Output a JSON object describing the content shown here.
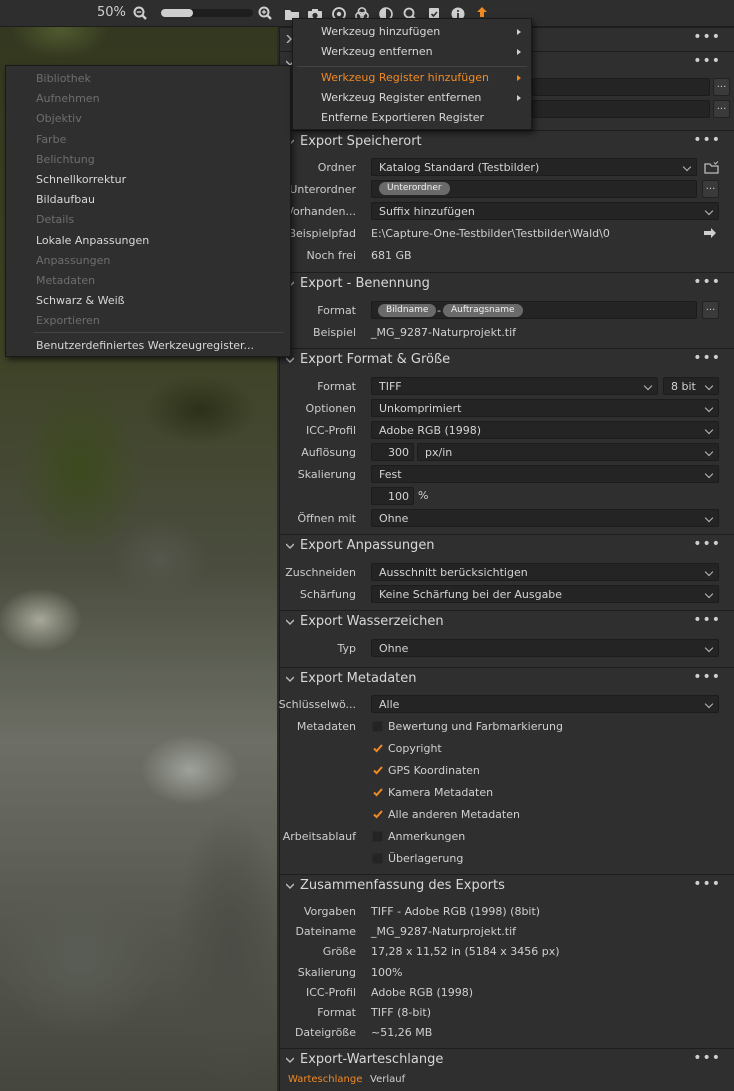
{
  "toolbar": {
    "zoom_percent": "50%",
    "zoom_level": 0.35
  },
  "menu_left": {
    "items": [
      {
        "label": "Bibliothek",
        "enabled": false
      },
      {
        "label": "Aufnehmen",
        "enabled": false
      },
      {
        "label": "Objektiv",
        "enabled": false
      },
      {
        "label": "Farbe",
        "enabled": false
      },
      {
        "label": "Belichtung",
        "enabled": false
      },
      {
        "label": "Schnellkorrektur",
        "enabled": true
      },
      {
        "label": "Bildaufbau",
        "enabled": true
      },
      {
        "label": "Details",
        "enabled": false
      },
      {
        "label": "Lokale Anpassungen",
        "enabled": true
      },
      {
        "label": "Anpassungen",
        "enabled": false
      },
      {
        "label": "Metadaten",
        "enabled": false
      },
      {
        "label": "Schwarz & Weiß",
        "enabled": true
      },
      {
        "label": "Exportieren",
        "enabled": false
      }
    ],
    "custom": "Benutzerdefiniertes Werkzeugregister..."
  },
  "menu_right": {
    "items": [
      {
        "label": "Werkzeug hinzufügen",
        "submenu": true
      },
      {
        "label": "Werkzeug entfernen",
        "submenu": true
      },
      {
        "label": "Werkzeug Register hinzufügen",
        "submenu": true,
        "highlighted": true
      },
      {
        "label": "Werkzeug Register entfernen",
        "submenu": true
      },
      {
        "label": "Entferne Exportieren Register",
        "submenu": false
      }
    ]
  },
  "speicherort": {
    "title": "Export Speicherort",
    "ordner_label": "Ordner",
    "ordner_value": "Katalog Standard (Testbilder)",
    "unterordner_label": "Unterordner",
    "unterordner_pill": "Unterordner",
    "vorhanden_label": "Vorhanden...",
    "vorhanden_value": "Suffix hinzufügen",
    "beispielpfad_label": "Beispielpfad",
    "beispielpfad_value": "E:\\Capture-One-Testbilder\\Testbilder\\Wald\\0",
    "nochfrei_label": "Noch frei",
    "nochfrei_value": "681 GB"
  },
  "benennung": {
    "title": "Export - Benennung",
    "format_label": "Format",
    "pill1": "Bildname",
    "dash": "-",
    "pill2": "Auftragsname",
    "beispiel_label": "Beispiel",
    "beispiel_value": "_MG_9287-Naturprojekt.tif"
  },
  "format": {
    "title": "Export Format & Größe",
    "format_label": "Format",
    "format_value": "TIFF",
    "bit_value": "8 bit",
    "optionen_label": "Optionen",
    "optionen_value": "Unkomprimiert",
    "icc_label": "ICC-Profil",
    "icc_value": "Adobe RGB (1998)",
    "aufl_label": "Auflösung",
    "aufl_value": "300",
    "aufl_unit": "px/in",
    "skal_label": "Skalierung",
    "skal_value": "Fest",
    "percent_value": "100",
    "percent_sign": "%",
    "oeffnen_label": "Öffnen mit",
    "oeffnen_value": "Ohne"
  },
  "anpassungen": {
    "title": "Export Anpassungen",
    "zuschneiden_label": "Zuschneiden",
    "zuschneiden_value": "Ausschnitt berücksichtigen",
    "schaerfung_label": "Schärfung",
    "schaerfung_value": "Keine Schärfung bei der Ausgabe"
  },
  "wasserzeichen": {
    "title": "Export Wasserzeichen",
    "typ_label": "Typ",
    "typ_value": "Ohne"
  },
  "metadaten": {
    "title": "Export Metadaten",
    "schluessel_label": "Schlüsselwö...",
    "schluessel_value": "Alle",
    "metadaten_label": "Metadaten",
    "arbeitsablauf_label": "Arbeitsablauf",
    "options": [
      {
        "label": "Bewertung und Farbmarkierung",
        "checked": false
      },
      {
        "label": "Copyright",
        "checked": true
      },
      {
        "label": "GPS Koordinaten",
        "checked": true
      },
      {
        "label": "Kamera Metadaten",
        "checked": true
      },
      {
        "label": "Alle anderen Metadaten",
        "checked": true
      },
      {
        "label": "Anmerkungen",
        "checked": false
      },
      {
        "label": "Überlagerung",
        "checked": false
      }
    ]
  },
  "zusammenfassung": {
    "title": "Zusammenfassung des Exports",
    "rows": [
      {
        "label": "Vorgaben",
        "value": "TIFF - Adobe RGB (1998) (8bit)"
      },
      {
        "label": "Dateiname",
        "value": "_MG_9287-Naturprojekt.tif"
      },
      {
        "label": "Größe",
        "value": "17,28 x 11,52 in (5184 x 3456 px)"
      },
      {
        "label": "Skalierung",
        "value": "100%"
      },
      {
        "label": "ICC-Profil",
        "value": "Adobe RGB (1998)"
      },
      {
        "label": "Format",
        "value": "TIFF (8-bit)"
      },
      {
        "label": "Dateigröße",
        "value": "~51,26 MB"
      }
    ]
  },
  "warteschlange": {
    "title": "Export-Warteschlange",
    "tab1": "Warteschlange",
    "tab2": "Verlauf"
  },
  "colors": {
    "accent": "#f08a24",
    "check": "#f08a24"
  }
}
